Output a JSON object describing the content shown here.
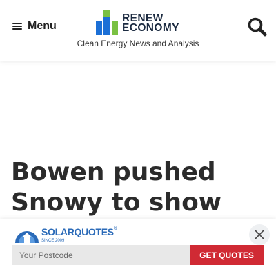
{
  "header": {
    "menu_label": "Menu",
    "logo": {
      "line1": "RENEW",
      "line2": "ECONOMY",
      "icon": "renew-economy-logo-icon"
    },
    "tagline": "Clean Energy News and Analysis",
    "search_icon": "search-icon"
  },
  "article": {
    "title": "Bowen pushed Snowy to show"
  },
  "promo": {
    "brand": "SOLARQUOTES",
    "brand_mark": "®",
    "since": "SINCE 2009",
    "postcode_placeholder": "Your Postcode",
    "button_label": "GET QUOTES",
    "close_icon": "close-icon"
  },
  "colors": {
    "logo_blue": "#1b6fd6",
    "logo_green": "#7ac142",
    "cta_red": "#d02a34",
    "solarquotes_blue": "#2a6ab8"
  }
}
